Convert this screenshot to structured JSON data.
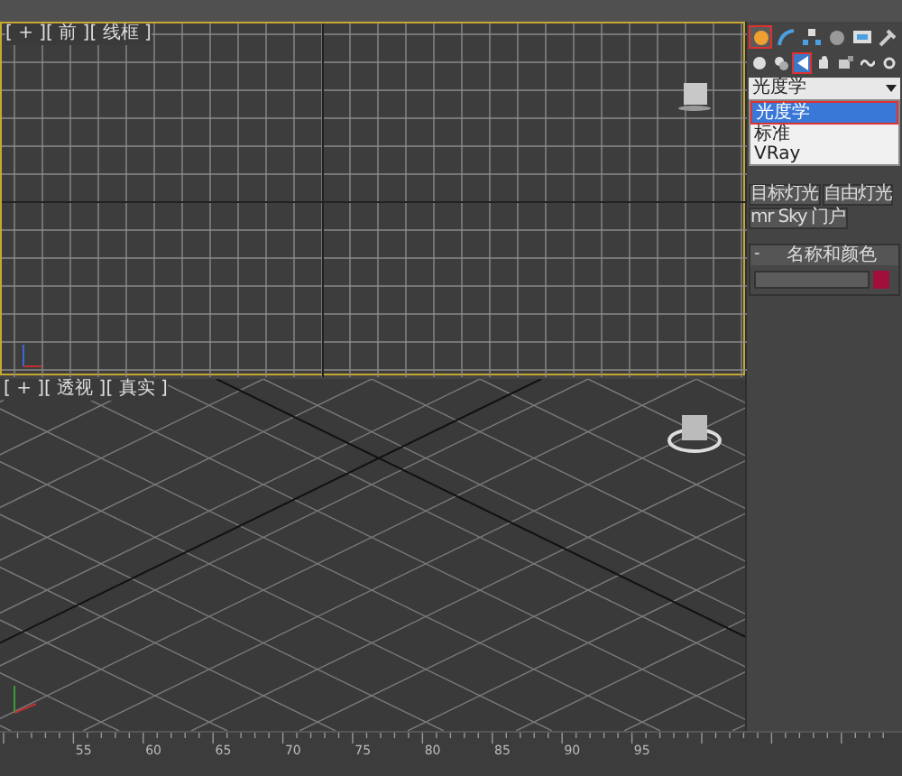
{
  "viewports": [
    {
      "kind": "ortho",
      "label": "[ + ][ 前 ][ 线框 ]"
    },
    {
      "kind": "perspective",
      "label": "[ + ][ 透视 ][ 真实 ]"
    }
  ],
  "command_tabs": [
    {
      "selected": true
    },
    {
      "selected": false
    },
    {
      "selected": false
    },
    {
      "selected": false
    },
    {
      "selected": false
    },
    {
      "selected": false
    }
  ],
  "categories": [
    {
      "selected": false
    },
    {
      "selected": false
    },
    {
      "selected": true
    },
    {
      "selected": false
    },
    {
      "selected": false
    },
    {
      "selected": false
    },
    {
      "selected": false
    }
  ],
  "light_type": {
    "value": "光度学",
    "options": [
      {
        "label": "光度学",
        "selected": true
      },
      {
        "label": "标准",
        "selected": false
      },
      {
        "label": "VRay",
        "selected": false
      }
    ]
  },
  "object_buttons": [
    "目标灯光",
    "自由灯光",
    "mr Sky 门户"
  ],
  "rollout": {
    "toggle": "-",
    "title": "名称和颜色",
    "expanded": true,
    "color": "#a0103a"
  },
  "ruler": {
    "ticks": [
      "55",
      "60",
      "65",
      "70",
      "75",
      "80",
      "85",
      "90",
      "95"
    ]
  }
}
